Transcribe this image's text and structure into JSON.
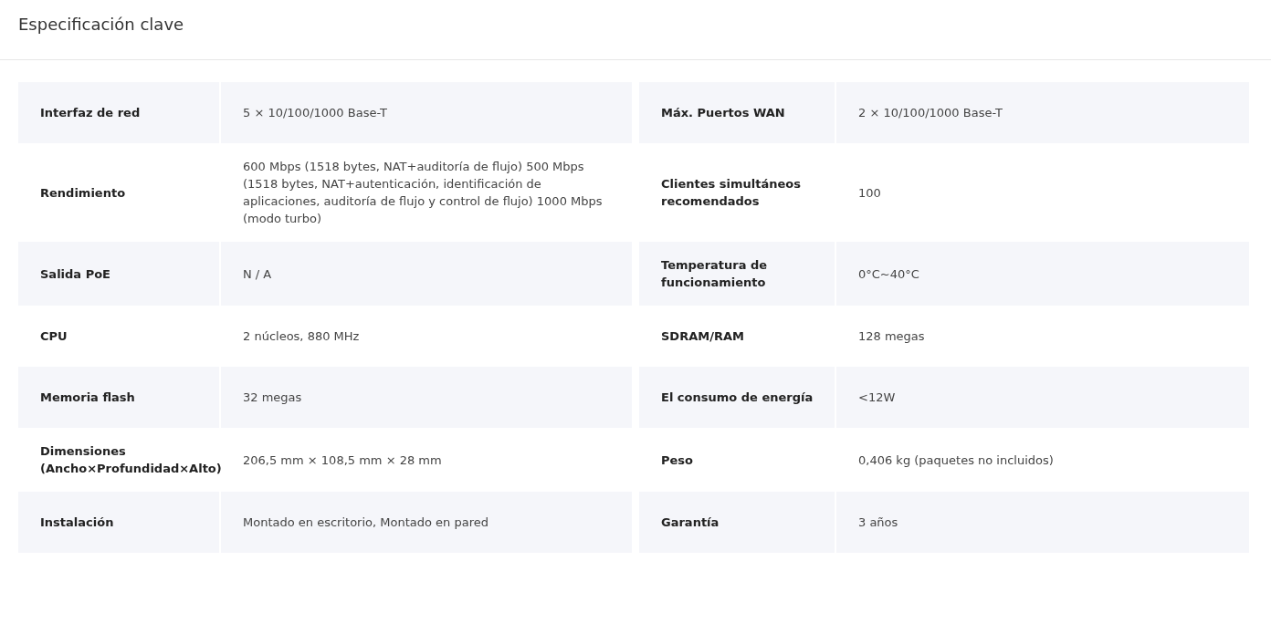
{
  "title": "Especificación clave",
  "rows": [
    {
      "left": {
        "label": "Interfaz de red",
        "value": "5 × 10/100/1000 Base-T"
      },
      "right": {
        "label": "Máx. Puertos WAN",
        "value": "2 × 10/100/1000 Base-T"
      }
    },
    {
      "left": {
        "label": "Rendimiento",
        "value": "600 Mbps (1518 bytes, NAT+auditoría de flujo) 500 Mbps (1518 bytes, NAT+autenticación, identificación de aplicaciones, auditoría de flujo y control de flujo) 1000 Mbps (modo turbo)"
      },
      "right": {
        "label": "Clientes simultáneos recomendados",
        "value": "100"
      }
    },
    {
      "left": {
        "label": "Salida PoE",
        "value": "N / A"
      },
      "right": {
        "label": "Temperatura de funcionamiento",
        "value": "0°C~40°C"
      }
    },
    {
      "left": {
        "label": "CPU",
        "value": "2 núcleos, 880 MHz"
      },
      "right": {
        "label": "SDRAM/RAM",
        "value": "128 megas"
      }
    },
    {
      "left": {
        "label": "Memoria flash",
        "value": "32 megas"
      },
      "right": {
        "label": "El consumo de energía",
        "value": "<12W"
      }
    },
    {
      "left": {
        "label": "Dimensiones (Ancho×Profundidad×Alto)",
        "value": "206,5 mm × 108,5 mm × 28 mm"
      },
      "right": {
        "label": "Peso",
        "value": "0,406 kg (paquetes no incluidos)"
      }
    },
    {
      "left": {
        "label": "Instalación",
        "value": "Montado en escritorio, Montado en pared"
      },
      "right": {
        "label": "Garantía",
        "value": "3 años"
      }
    }
  ]
}
